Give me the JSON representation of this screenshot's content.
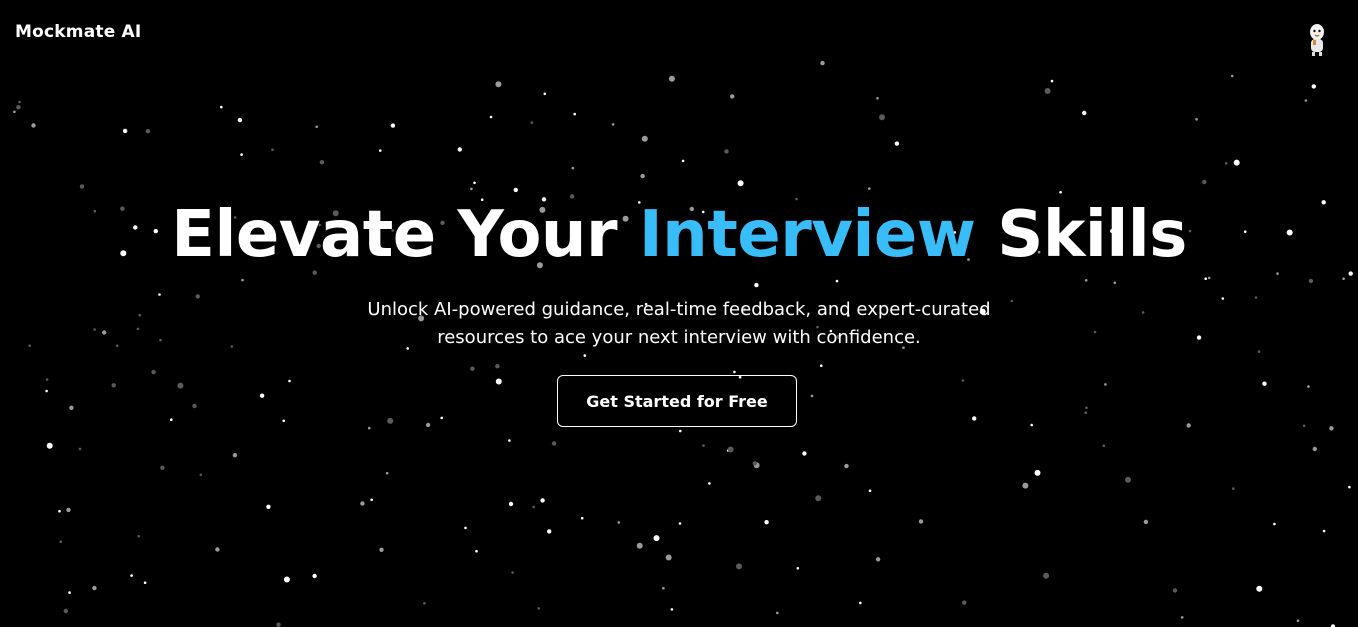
{
  "header": {
    "brand": "Mockmate AI",
    "avatar_icon": "user-avatar-icon"
  },
  "hero": {
    "title_part1": "Elevate Your ",
    "title_accent": "Interview",
    "title_part2": " Skills",
    "subtitle_line1": "Unlock AI-powered guidance, real-time feedback, and expert-curated",
    "subtitle_line2": "resources to ace your next interview with confidence.",
    "cta_label": "Get Started for Free"
  },
  "colors": {
    "background": "#000000",
    "accent": "#38bdf8",
    "text": "#ffffff"
  },
  "background": {
    "effect": "starfield-particles"
  }
}
